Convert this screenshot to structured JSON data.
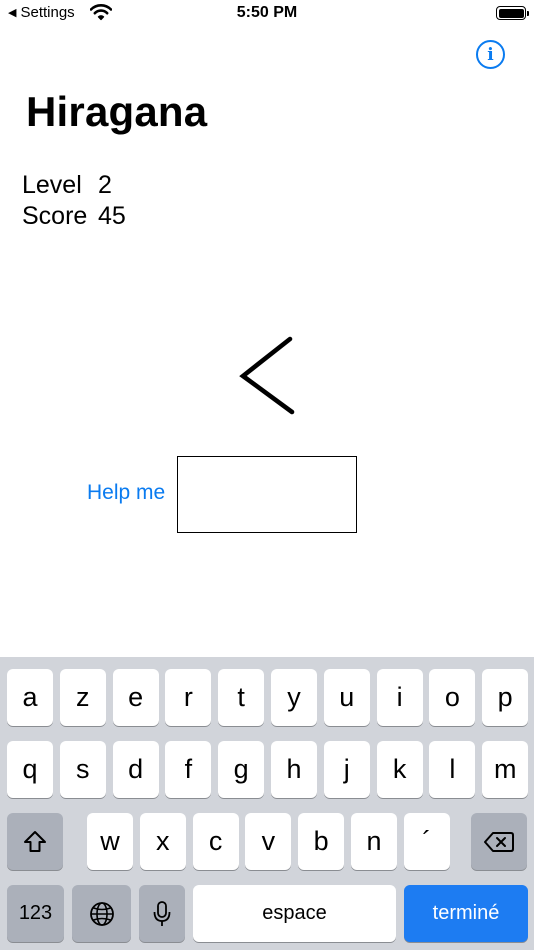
{
  "status_bar": {
    "back_label": "Settings",
    "time": "5:50 PM"
  },
  "header": {
    "title": "Hiragana",
    "info_icon": "info-circle-icon"
  },
  "stats": {
    "level_label": "Level",
    "level_value": "2",
    "score_label": "Score",
    "score_value": "45"
  },
  "quiz": {
    "help_label": "Help me",
    "answer_value": ""
  },
  "keyboard": {
    "row1": [
      "a",
      "z",
      "e",
      "r",
      "t",
      "y",
      "u",
      "i",
      "o",
      "p"
    ],
    "row2": [
      "q",
      "s",
      "d",
      "f",
      "g",
      "h",
      "j",
      "k",
      "l",
      "m"
    ],
    "row3": [
      "w",
      "x",
      "c",
      "v",
      "b",
      "n",
      "´"
    ],
    "numbers_label": "123",
    "space_label": "espace",
    "done_label": "terminé"
  },
  "colors": {
    "accent": "#0a7bf0",
    "keyboard_bg": "#d1d4da",
    "done_key": "#1d7cf2"
  }
}
